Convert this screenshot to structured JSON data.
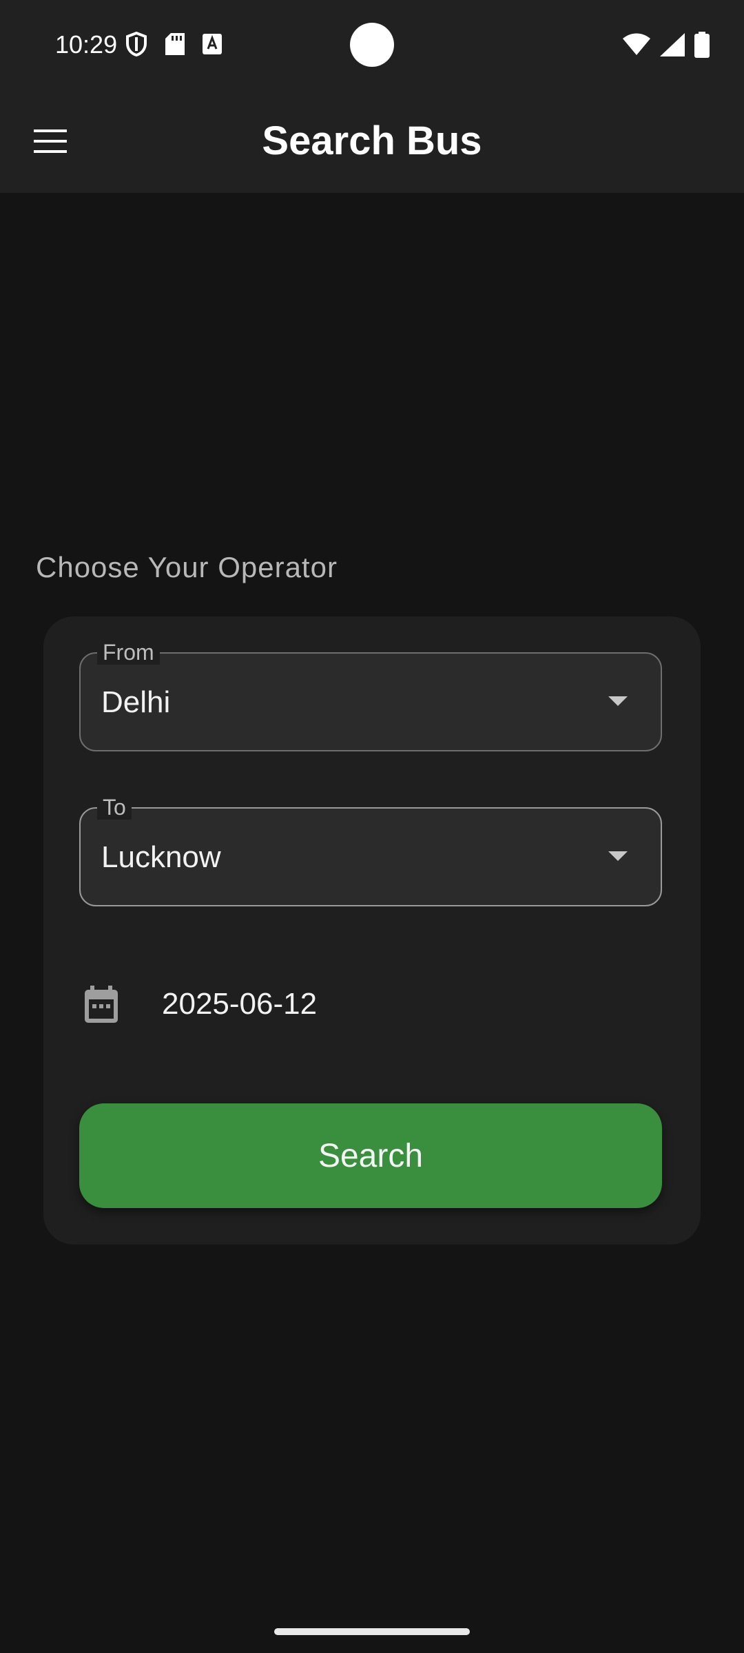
{
  "status_bar": {
    "time": "10:29",
    "left_icons": [
      "shield-icon",
      "sd-card-icon",
      "text-a-icon"
    ],
    "right_icons": [
      "wifi-icon",
      "signal-icon",
      "battery-icon"
    ]
  },
  "app_bar": {
    "title": "Search Bus",
    "menu_icon": "hamburger-menu-icon"
  },
  "section": {
    "label": "Choose Your Operator"
  },
  "form": {
    "from": {
      "label": "From",
      "value": "Delhi"
    },
    "to": {
      "label": "To",
      "value": "Lucknow"
    },
    "date": {
      "value": "2025-06-12",
      "icon": "calendar-icon"
    },
    "search_label": "Search"
  },
  "colors": {
    "background": "#141414",
    "app_bar": "#212121",
    "card": "#1f1f1f",
    "accent_green": "#3a8f3f"
  }
}
